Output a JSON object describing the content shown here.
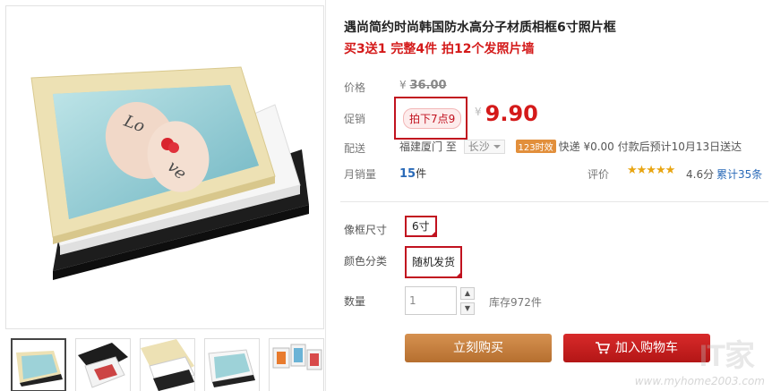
{
  "product": {
    "title": "遇尚简约时尚韩国防水高分子材质相框6寸照片框",
    "subtitle": "买3送1 完整4件 拍12个发照片墙"
  },
  "price": {
    "label": "价格",
    "currency": "¥",
    "original": "36.00"
  },
  "promotion": {
    "label": "促销",
    "tag": "拍下7点9",
    "currency": "¥",
    "price": "9.90"
  },
  "shipping": {
    "label": "配送",
    "from": "福建厦门",
    "to_label": "至",
    "to_city": "长沙",
    "badge": "123时效",
    "info": "快递 ¥0.00 付款后预计10月13日送达"
  },
  "sales": {
    "label": "月销量",
    "count": "15",
    "unit": "件"
  },
  "rating": {
    "label": "评价",
    "stars": "★★★★★",
    "score": "4.6分",
    "count": "累计35条"
  },
  "options": {
    "size_label": "像框尺寸",
    "size_value": "6寸",
    "color_label": "颜色分类",
    "color_value": "随机发货"
  },
  "quantity": {
    "label": "数量",
    "value": "1",
    "stock": "库存972件"
  },
  "buttons": {
    "buy_now": "立刻购买",
    "add_to_cart": "加入购物车"
  },
  "watermark": {
    "logo": "IT家",
    "url": "www.myhome2003.com"
  },
  "colors": {
    "accent_red": "#d41a1a",
    "buy_now": "#c8803f",
    "add_cart": "#c81623"
  }
}
